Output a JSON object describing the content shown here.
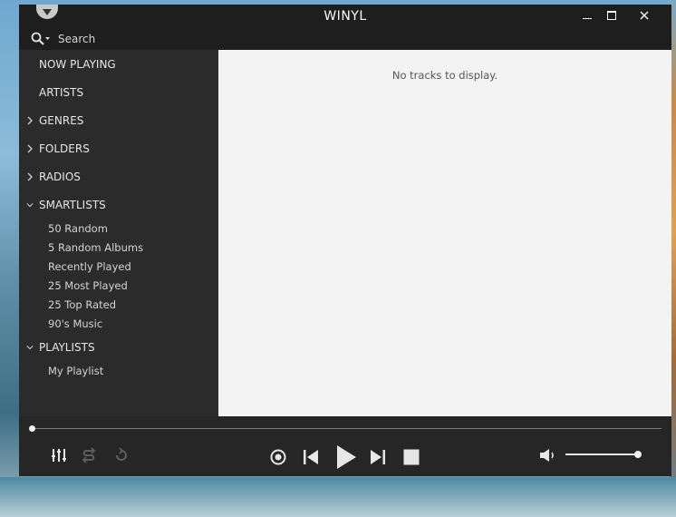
{
  "window": {
    "title": "WINYL"
  },
  "search": {
    "label": "Search"
  },
  "sidebar": {
    "items": [
      {
        "label": "NOW PLAYING",
        "chevron": ""
      },
      {
        "label": "ARTISTS",
        "chevron": ""
      },
      {
        "label": "GENRES",
        "chevron": "chevron-right"
      },
      {
        "label": "FOLDERS",
        "chevron": "chevron-right"
      },
      {
        "label": "RADIOS",
        "chevron": "chevron-right"
      },
      {
        "label": "SMARTLISTS",
        "chevron": "chevron-down"
      },
      {
        "label": "PLAYLISTS",
        "chevron": "chevron-down"
      }
    ],
    "smartlists": [
      "50 Random",
      "5 Random Albums",
      "Recently Played",
      "25 Most Played",
      "25 Top Rated",
      "90's Music"
    ],
    "playlists": [
      "My Playlist"
    ]
  },
  "content": {
    "empty_message": "No tracks to display."
  },
  "player": {
    "seek_position": 0,
    "volume_level": 1.0,
    "icons": [
      "equalizer-icon",
      "shuffle-icon",
      "repeat-icon",
      "record-icon",
      "previous-icon",
      "play-icon",
      "next-icon",
      "stop-icon",
      "volume-icon"
    ]
  },
  "colors": {
    "titlebar": "#1e1e1e",
    "sidebar": "#2b2b2b",
    "content": "#f3f3f3",
    "player": "#262626"
  }
}
